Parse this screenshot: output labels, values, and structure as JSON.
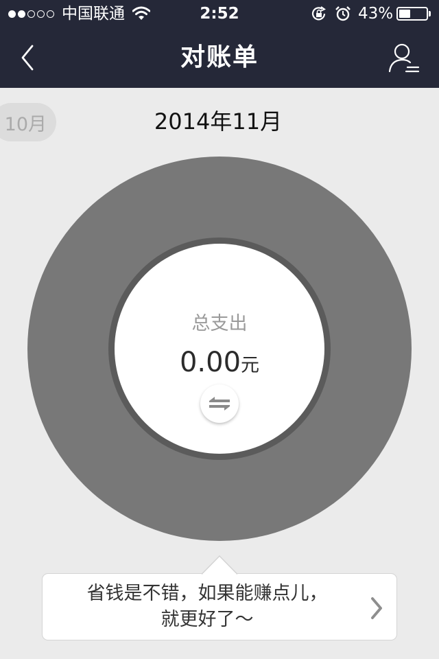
{
  "status_bar": {
    "signal_filled": 2,
    "signal_total": 5,
    "carrier": "中国联通",
    "time": "2:52",
    "battery_text": "43%",
    "battery_level": 0.43,
    "icons": [
      "wifi-icon",
      "rotation-lock-icon",
      "alarm-icon",
      "battery-icon"
    ]
  },
  "nav": {
    "title": "对账单",
    "back_icon": "chevron-left-icon",
    "right_icon": "user-menu-icon"
  },
  "month": {
    "previous": "10月",
    "current": "2014年11月"
  },
  "summary": {
    "label": "总支出",
    "amount": "0.00",
    "unit": "元",
    "switch_icon": "swap-arrows-icon"
  },
  "tip": {
    "line1": "省钱是不错，如果能赚点儿，",
    "line2": "就更好了～",
    "chevron_icon": "chevron-right-icon"
  },
  "colors": {
    "header_bg": "#252838",
    "page_bg": "#ebebeb",
    "donut": "#787878",
    "donut_ring": "#5b5b5b"
  }
}
